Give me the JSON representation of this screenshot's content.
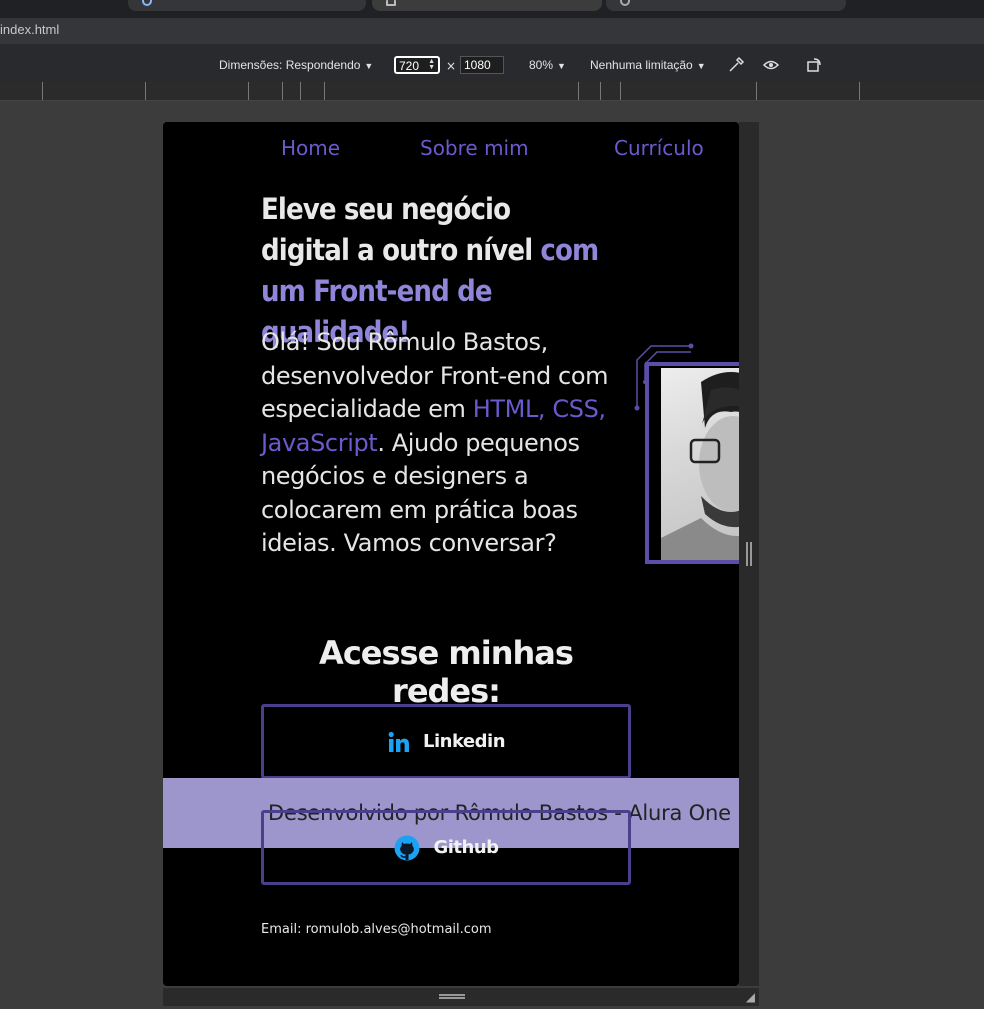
{
  "browser": {
    "url_text": "index.html"
  },
  "devtools": {
    "dimensions_label": "Dimensões: Respondendo",
    "width_value": "720",
    "times_sign": "×",
    "height_value": "1080",
    "zoom_label": "80%",
    "throttle_label": "Nenhuma limitação",
    "icons": [
      "eyedropper-icon",
      "eye-icon",
      "rotate-icon"
    ]
  },
  "page": {
    "nav": [
      {
        "label": "Home"
      },
      {
        "label": "Sobre mim"
      },
      {
        "label": "Currículo"
      }
    ],
    "headline": {
      "part1": "Eleve seu negócio digital a outro nível ",
      "accent": "com um Front-end de qualidade!"
    },
    "intro": {
      "before": "Olá! Sou Rômulo Bastos, desenvolvedor Front-end com especialidade em ",
      "highlight": "HTML, CSS, JavaScript",
      "after": ". Ajudo pequenos negócios e designers a colocarem em prática boas ideias. Vamos conversar?"
    },
    "social_title": "Acesse minhas redes:",
    "buttons": [
      {
        "label": "Linkedin",
        "icon": "linkedin-icon"
      },
      {
        "label": "Github",
        "icon": "github-icon"
      }
    ],
    "footer_text": "Desenvolvido por Rômulo Bastos - Alura One",
    "email": "Email: romulob.alves@hotmail.com"
  },
  "colors": {
    "accent": "#6a5acd",
    "accent_light": "#8f86d9",
    "footer_bg": "#9c96cc",
    "page_bg": "#000000"
  }
}
